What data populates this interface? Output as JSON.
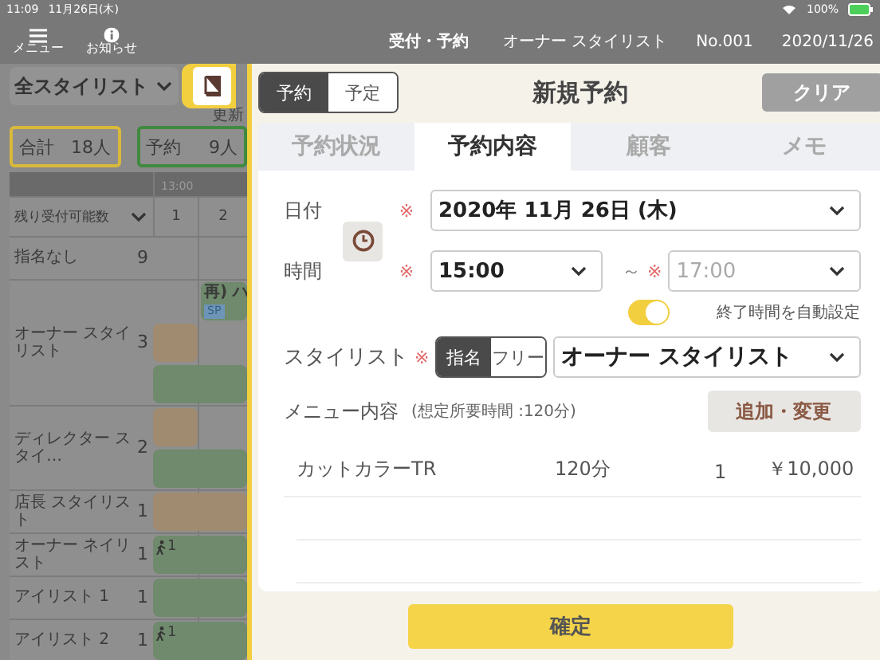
{
  "status_bar": {
    "time": "11:09",
    "date": "11月26日(木)",
    "battery": "100%"
  },
  "header": {
    "menu_label": "メニュー",
    "notice_label": "お知らせ",
    "title": "受付・予約",
    "staff": "オーナー スタイリスト",
    "number": "No.001",
    "date": "2020/11/26"
  },
  "left_pane": {
    "stylist_filter": "全スタイリスト",
    "refresh": "更新",
    "totals": [
      {
        "label": "合計",
        "value": "18人",
        "color": "#d9b93a"
      },
      {
        "label": "予約",
        "value": "9人",
        "color": "#3f8a3f"
      }
    ],
    "schedule": {
      "time_label": "13:00",
      "remaining_label": "残り受付可能数",
      "slots": [
        "1",
        "2"
      ],
      "rows": [
        {
          "name": "指名なし",
          "count": "9",
          "bookings": []
        },
        {
          "name": "オーナー スタイリスト",
          "count": "3",
          "bookings": [
            {
              "kind": "late",
              "color": "#6f8a6c",
              "label": "再) ハ",
              "tag": "SP"
            },
            {
              "kind": "early",
              "color": "#a08b70"
            },
            {
              "kind": "full",
              "color": "#6f8a6c"
            }
          ]
        },
        {
          "name": "ディレクター スタイ…",
          "count": "2",
          "bookings": [
            {
              "kind": "early",
              "color": "#a08b70"
            },
            {
              "kind": "full",
              "color": "#6f8a6c"
            }
          ]
        },
        {
          "name": "店長 スタイリスト",
          "count": "1",
          "bookings": [
            {
              "kind": "full",
              "color": "#a08b70"
            }
          ]
        },
        {
          "name": "オーナー ネイリスト",
          "count": "1",
          "bookings": [
            {
              "kind": "full",
              "color": "#6f8a6c",
              "count": "1"
            }
          ]
        },
        {
          "name": "アイリスト 1",
          "count": "1",
          "bookings": [
            {
              "kind": "full",
              "color": "#6f8a6c"
            }
          ]
        },
        {
          "name": "アイリスト 2",
          "count": "1",
          "bookings": [
            {
              "kind": "full",
              "color": "#6f8a6c",
              "count": "1"
            }
          ]
        }
      ]
    }
  },
  "booking_panel": {
    "modes": [
      {
        "label": "予約",
        "selected": true
      },
      {
        "label": "予定",
        "selected": false
      }
    ],
    "title": "新規予約",
    "clear_button": "クリア",
    "tabs": [
      {
        "label": "予約状況",
        "selected": false
      },
      {
        "label": "予約内容",
        "selected": true
      },
      {
        "label": "顧客",
        "selected": false
      },
      {
        "label": "メモ",
        "selected": false
      }
    ],
    "form": {
      "date": {
        "label": "日付",
        "mark": "※",
        "value": "2020年 11月 26日 (木)"
      },
      "time": {
        "label": "時間",
        "start_mark": "※",
        "start": "15:00",
        "separator": "～",
        "end_mark": "※",
        "end": "17:00"
      },
      "auto_end": {
        "label": "終了時間を自動設定",
        "on": true
      },
      "stylist": {
        "label": "スタイリスト",
        "mark": "※",
        "modes": [
          {
            "label": "指名",
            "selected": true
          },
          {
            "label": "フリー",
            "selected": false
          }
        ],
        "value": "オーナー スタイリスト"
      },
      "menu": {
        "label": "メニュー内容",
        "note": "(想定所要時間 :120分)",
        "button": "追加・変更",
        "items": [
          {
            "name": "カットカラーTR",
            "duration": "120分",
            "quantity": "1",
            "price": "￥10,000"
          }
        ]
      }
    },
    "confirm_button": "確定"
  }
}
